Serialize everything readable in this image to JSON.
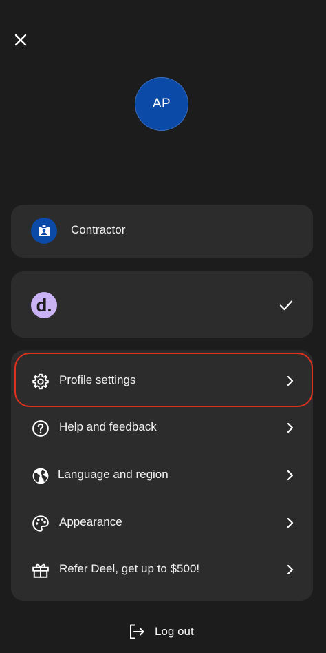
{
  "header": {
    "close_icon": "close-icon"
  },
  "profile": {
    "initials": "AP",
    "avatar_color": "#0b4aa6"
  },
  "role_card": {
    "icon": "badge-icon",
    "label": "Contractor"
  },
  "org_card": {
    "logo_text": "d.",
    "logo_color": "#c9b3f5",
    "selected": true,
    "check_icon": "checkmark-icon"
  },
  "menu": {
    "items": [
      {
        "label": "Profile settings",
        "icon": "gear-icon",
        "highlighted": true
      },
      {
        "label": "Help and feedback",
        "icon": "help-circle-icon"
      },
      {
        "label": "Language and region",
        "icon": "globe-icon"
      },
      {
        "label": "Appearance",
        "icon": "palette-icon"
      },
      {
        "label": "Refer Deel, get up to $500!",
        "icon": "gift-icon"
      }
    ]
  },
  "logout": {
    "label": "Log out",
    "icon": "logout-icon"
  },
  "colors": {
    "background": "#1c1c1c",
    "card": "#2c2c2c",
    "highlight_ring": "#e0301e"
  }
}
